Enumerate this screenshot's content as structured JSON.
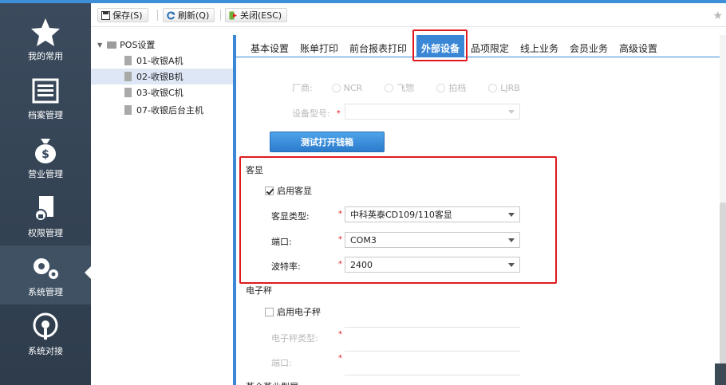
{
  "sidenav": {
    "items": [
      {
        "label": "我的常用",
        "icon": "star-icon"
      },
      {
        "label": "档案管理",
        "icon": "archive-icon"
      },
      {
        "label": "营业管理",
        "icon": "money-bag-icon"
      },
      {
        "label": "权限管理",
        "icon": "lock-doc-icon"
      },
      {
        "label": "系统管理",
        "icon": "gears-icon"
      },
      {
        "label": "系统对接",
        "icon": "connect-icon"
      }
    ],
    "active": "系统管理"
  },
  "toolbar": {
    "save_label": "保存(S)",
    "refresh_label": "刷新(Q)",
    "close_label": "关闭(ESC)"
  },
  "tree": {
    "root": "POS设置",
    "items": [
      "01-收银A机",
      "02-收银B机",
      "03-收银C机",
      "07-收银后台主机"
    ],
    "selected": "02-收银B机"
  },
  "tabs": [
    "基本设置",
    "账单打印",
    "前台报表打印",
    "外部设备",
    "品项限定",
    "线上业务",
    "会员业务",
    "高级设置"
  ],
  "active_tab": "外部设备",
  "cashbox": {
    "vendor_label": "厂商:",
    "vendor_options": [
      "NCR",
      "飞惣",
      "拍档",
      "LJRB"
    ],
    "model_label": "设备型号:",
    "model_value": "",
    "test_button": "测试打开钱箱"
  },
  "customer_display": {
    "title": "客显",
    "enable_label": "启用客显",
    "enabled": true,
    "type_label": "客显类型:",
    "type_value": "中科英泰CD109/110客显",
    "port_label": "端口:",
    "port_value": "COM3",
    "baud_label": "波特率:",
    "baud_value": "2400"
  },
  "scale": {
    "title": "电子秤",
    "enable_label": "启用电子秤",
    "enabled": false,
    "type_label": "电子秤类型:",
    "port_label": "端口:"
  },
  "next_section": "蒸仓蒸业型展"
}
